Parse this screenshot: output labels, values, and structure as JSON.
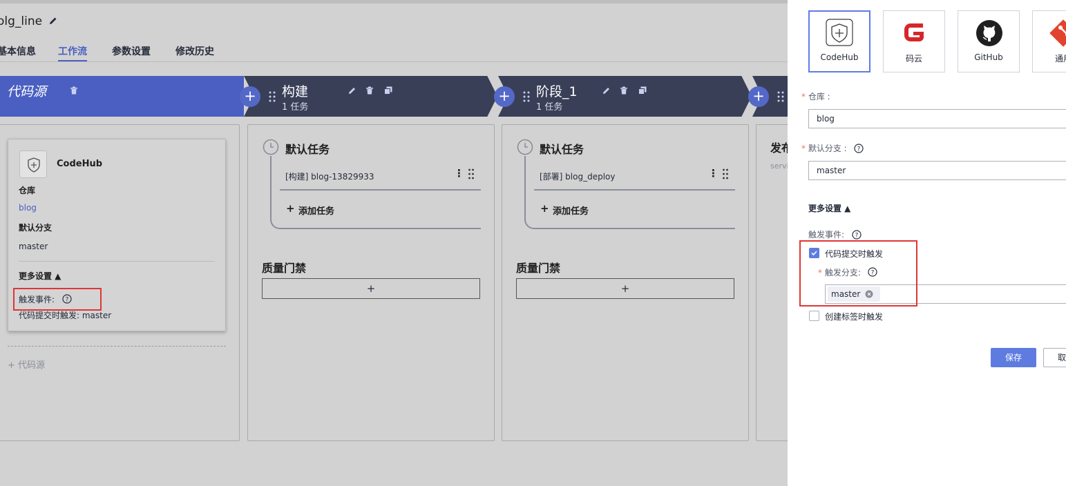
{
  "header": {
    "title": "olg_line"
  },
  "tabs": [
    "基本信息",
    "工作流",
    "参数设置",
    "修改历史"
  ],
  "stages": {
    "source": {
      "title": "代码源"
    },
    "build": {
      "title": "构建",
      "sub": "1 任务"
    },
    "stage1": {
      "title": "阶段_1",
      "sub": "1 任务"
    },
    "next": {
      "title": "发布",
      "sub": "servi"
    }
  },
  "source_card": {
    "name": "CodeHub",
    "repo_label": "仓库",
    "repo_value": "blog",
    "branch_label": "默认分支",
    "branch_value": "master",
    "more_label": "更多设置 ▲",
    "trigger_label": "触发事件:",
    "trigger_value": "代码提交时触发: master",
    "add_source": "+ 代码源"
  },
  "build_column": {
    "group": "默认任务",
    "task": "[构建] blog-13829933",
    "add_task": "添加任务",
    "gate": "质量门禁",
    "gate_add": "+"
  },
  "stage1_column": {
    "group": "默认任务",
    "task": "[部署] blog_deploy",
    "add_task": "添加任务",
    "gate": "质量门禁",
    "gate_add": "+"
  },
  "panel": {
    "sources": [
      "CodeHub",
      "码云",
      "GitHub",
      "通用"
    ],
    "repo_label": "仓库 :",
    "repo_value": "blog",
    "branch_label": "默认分支 :",
    "branch_value": "master",
    "more_label": "更多设置 ▲",
    "trigger_label": "触发事件:",
    "commit_trigger": "代码提交时触发",
    "trigger_branch_label": "触发分支:",
    "trigger_branch_tag": "master",
    "tag_trigger": "创建标签时触发",
    "save": "保存",
    "cancel": "取"
  },
  "colors": {
    "accent": "#5e7ce0",
    "stage_dark": "#3a3f58",
    "stage_source": "#4a5fc1",
    "highlight": "#e03535"
  }
}
